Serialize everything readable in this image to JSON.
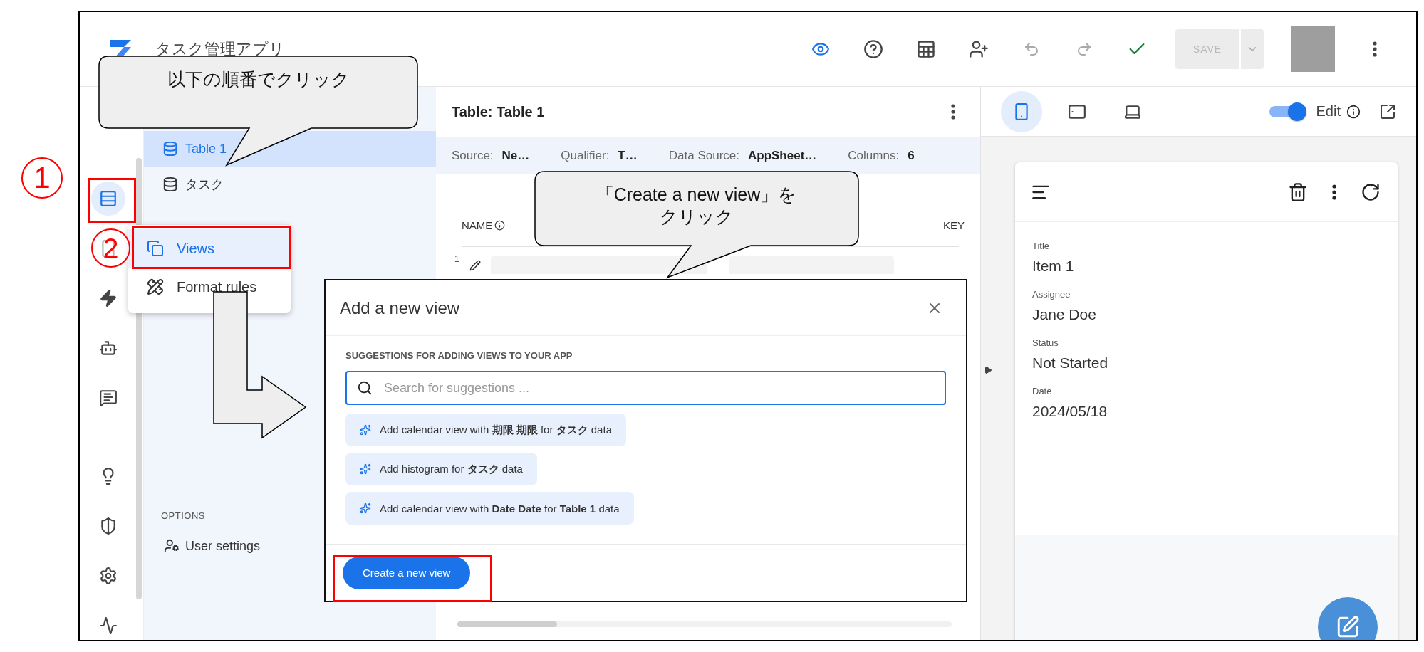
{
  "app_bar": {
    "title": "タスク管理アプリ",
    "save": {
      "label": "SAVE",
      "disabled": true
    }
  },
  "rail": {
    "top": [
      {
        "kind": "data",
        "selected": true
      },
      {
        "kind": "app",
        "selected": false
      },
      {
        "kind": "automation",
        "selected": false
      },
      {
        "kind": "bot",
        "selected": false
      },
      {
        "kind": "chat",
        "selected": false
      }
    ],
    "bottom": [
      {
        "kind": "tips",
        "selected": false
      },
      {
        "kind": "security",
        "selected": false
      },
      {
        "kind": "settings",
        "selected": false
      },
      {
        "kind": "monitor",
        "selected": false
      }
    ]
  },
  "nav": {
    "tables": [
      {
        "label": "Table 1",
        "selected": true
      },
      {
        "label": "タスク",
        "selected": false
      }
    ],
    "options_heading": "OPTIONS",
    "options": [
      {
        "label": "User settings"
      }
    ]
  },
  "menu": {
    "items": [
      {
        "label": "Views",
        "selected": true
      },
      {
        "label": "Format rules",
        "selected": false
      }
    ]
  },
  "table_panel": {
    "title": "Table: Table 1",
    "meta": [
      {
        "label": "Source:",
        "value": "Ne…"
      },
      {
        "label": "Qualifier:",
        "value": "T…"
      },
      {
        "label": "Data Source:",
        "value": "AppSheet…"
      },
      {
        "label": "Columns:",
        "value": "6"
      }
    ],
    "columns": [
      "NAME",
      "KEY"
    ],
    "rows": [
      {
        "number": "1"
      }
    ]
  },
  "preview": {
    "devices": [
      {
        "kind": "phone",
        "selected": true
      },
      {
        "kind": "tablet",
        "selected": false
      },
      {
        "kind": "desktop",
        "selected": false
      }
    ],
    "edit_toggle": {
      "label": "Edit",
      "on": true
    },
    "fields": [
      {
        "label": "Title",
        "value": "Item 1"
      },
      {
        "label": "Assignee",
        "value": "Jane Doe"
      },
      {
        "label": "Status",
        "value": "Not Started"
      },
      {
        "label": "Date",
        "value": "2024/05/18"
      }
    ]
  },
  "dialog": {
    "title": "Add a new view",
    "section": "SUGGESTIONS FOR ADDING VIEWS TO YOUR APP",
    "search": {
      "placeholder": "Search for suggestions ..."
    },
    "suggestions": [
      "Add calendar view with **期限 期限** for **タスク** data",
      "Add histogram for **タスク** data",
      "Add calendar view with **Date Date** for **Table 1** data"
    ],
    "primary_button": "Create a new view"
  },
  "annotations": {
    "callouts": [
      {
        "lines": [
          "以下の順番でクリック"
        ]
      },
      {
        "lines": [
          "「Create a new view」を",
          "クリック"
        ]
      }
    ],
    "steps": [
      "1",
      "2"
    ]
  }
}
